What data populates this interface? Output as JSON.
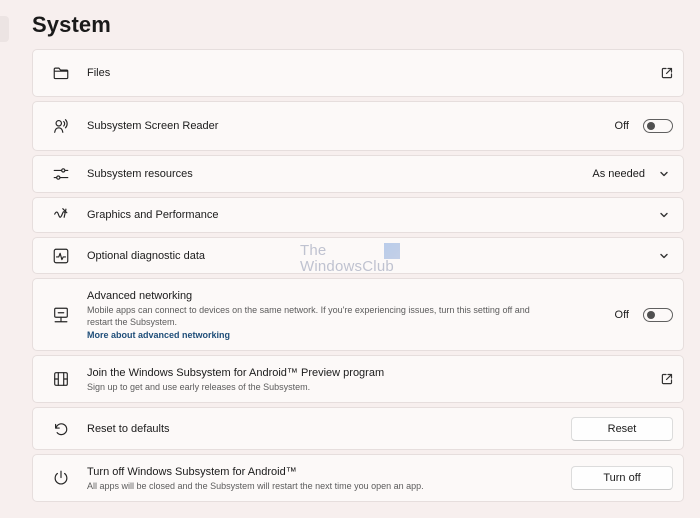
{
  "page": {
    "title": "System"
  },
  "rows": {
    "files": {
      "label": "Files",
      "icon": "folder-icon",
      "action_icon": "external-link-icon"
    },
    "screen_reader": {
      "label": "Subsystem Screen Reader",
      "icon": "screen-reader-icon",
      "state": "Off",
      "toggle_on": false
    },
    "resources": {
      "label": "Subsystem resources",
      "icon": "sliders-icon",
      "value": "As needed"
    },
    "graphics": {
      "label": "Graphics and Performance",
      "icon": "graphics-icon"
    },
    "diagnostic": {
      "label": "Optional diagnostic data",
      "icon": "activity-icon"
    },
    "networking": {
      "label": "Advanced networking",
      "icon": "network-icon",
      "description": "Mobile apps can connect to devices on the same network. If you're experiencing issues, turn this setting off and restart the Subsystem.",
      "link": "More about advanced networking",
      "state": "Off",
      "toggle_on": false
    },
    "preview": {
      "label": "Join the Windows Subsystem for Android™ Preview program",
      "icon": "preview-program-icon",
      "description": "Sign up to get and use early releases of the Subsystem.",
      "action_icon": "external-link-icon"
    },
    "reset": {
      "label": "Reset to defaults",
      "icon": "reset-icon",
      "button": "Reset"
    },
    "turn_off": {
      "label": "Turn off Windows Subsystem for Android™",
      "icon": "power-icon",
      "description": "All apps will be closed and the Subsystem will restart the next time you open an app.",
      "button": "Turn off"
    }
  },
  "watermark": {
    "line1": "The",
    "line2": "WindowsClub"
  },
  "colors": {
    "background": "#f7efee",
    "card": "#fcf9f8",
    "card_border": "#e6dedd",
    "link": "#1f4e79"
  }
}
